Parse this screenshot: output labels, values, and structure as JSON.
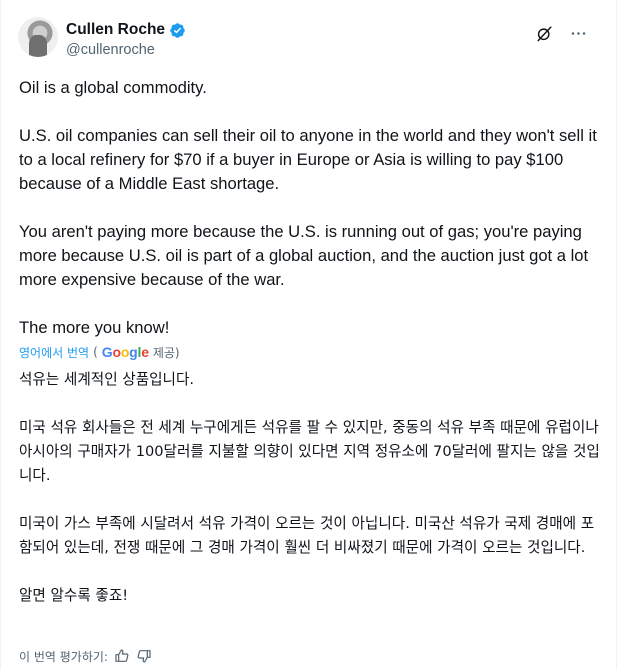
{
  "author": {
    "display_name": "Cullen Roche",
    "handle": "@cullenroche",
    "verified_icon": "verified-badge-icon",
    "accent_color": "#1d9bf0"
  },
  "actions": {
    "grok_icon": "grok-slash-icon",
    "more_icon": "more-dots-icon"
  },
  "tweet": {
    "paragraphs": [
      "Oil is a global commodity.",
      "U.S. oil companies can sell their oil to anyone in the world and they won't sell it to a local refinery for $70 if a buyer in Europe or Asia is willing to pay $100 because of a Middle East shortage.",
      "You aren't paying more because the U.S. is running out of gas; you're paying more because U.S. oil is part of a global auction, and the auction just got a lot more expensive because of the war.",
      "The more you know!"
    ]
  },
  "translation": {
    "link_label": "영어에서 번역",
    "provider_prefix": "(",
    "provider_name_parts": [
      "G",
      "o",
      "o",
      "g",
      "l",
      "e"
    ],
    "provider_suffix": "제공)",
    "paragraphs": [
      "석유는 세계적인 상품입니다.",
      "미국 석유 회사들은 전 세계 누구에게든 석유를 팔 수 있지만, 중동의 석유 부족 때문에 유럽이나 아시아의 구매자가 100달러를 지불할 의향이 있다면 지역 정유소에 70달러에 팔지는 않을 것입니다.",
      "미국이 가스 부족에 시달려서 석유 가격이 오르는 것이 아닙니다. 미국산 석유가 국제 경매에 포함되어 있는데, 전쟁 때문에 그 경매 가격이 훨씬 더 비싸졌기 때문에 가격이 오르는 것입니다.",
      "알면 알수록 좋죠!"
    ],
    "rate_label": "이 번역 평가하기:",
    "thumbs_up_icon": "thumbs-up-icon",
    "thumbs_down_icon": "thumbs-down-icon"
  }
}
